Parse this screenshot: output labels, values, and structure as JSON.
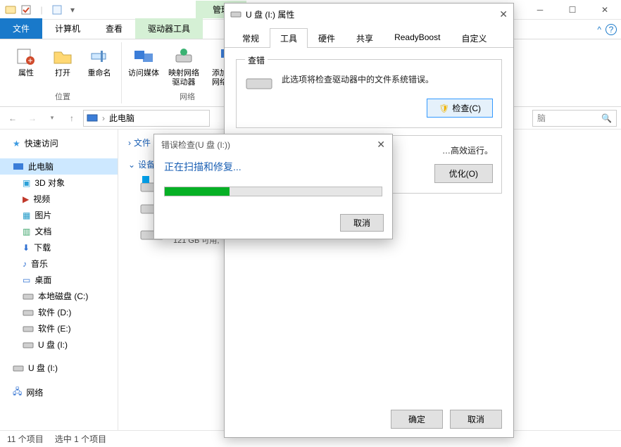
{
  "titlebar": {
    "context_tab": "管理",
    "breadcrumb": "此电脑"
  },
  "ribbon_tabs": {
    "file": "文件",
    "computer": "计算机",
    "view": "查看",
    "drive_tools": "驱动器工具"
  },
  "ribbon": {
    "location": {
      "props": "属性",
      "open": "打开",
      "rename": "重命名",
      "label": "位置"
    },
    "network": {
      "media": "访问媒体",
      "map": "映射网络\n驱动器",
      "addloc": "添加一个\n网络位置",
      "label": "网络"
    }
  },
  "addr": {
    "thispc": "此电脑"
  },
  "search": {
    "placeholder": "脑"
  },
  "tree": {
    "quick": "快速访问",
    "thispc": "此电脑",
    "objects3d": "3D 对象",
    "videos": "视频",
    "pictures": "图片",
    "documents": "文档",
    "downloads": "下载",
    "music": "音乐",
    "desktop": "桌面",
    "localc": "本地磁盘 (C:)",
    "softd": "软件 (D:)",
    "softe": "软件 (E:)",
    "udisk1": "U 盘 (I:)",
    "udisk2": "U 盘 (I:)",
    "network": "网络"
  },
  "content": {
    "group_files": "文件",
    "group_devices": "设备和",
    "drive_free": "121 GB 可用,"
  },
  "status": {
    "items": "11 个项目",
    "selected": "选中 1 个项目"
  },
  "propdlg": {
    "title": "U 盘 (I:) 属性",
    "tabs": {
      "general": "常规",
      "tools": "工具",
      "hardware": "硬件",
      "sharing": "共享",
      "readyboost": "ReadyBoost",
      "custom": "自定义"
    },
    "check": {
      "legend": "查错",
      "desc": "此选项将检查驱动器中的文件系统错误。",
      "btn": "检查(C)"
    },
    "optimize": {
      "desc": "…高效运行。",
      "btn": "优化(O)"
    },
    "ok": "确定",
    "cancel": "取消"
  },
  "errdlg": {
    "title": "错误检查(U 盘 (I:))",
    "msg": "正在扫描和修复...",
    "cancel": "取消"
  }
}
